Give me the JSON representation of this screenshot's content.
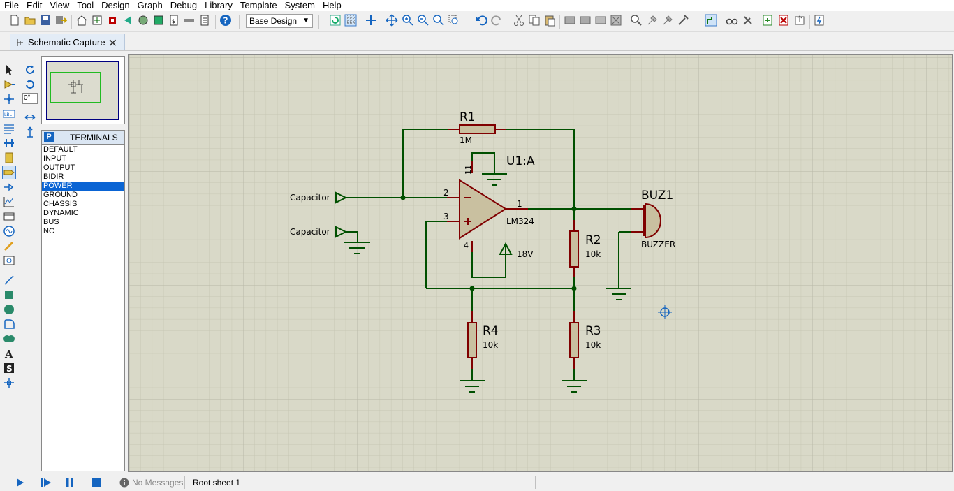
{
  "menu": [
    "File",
    "Edit",
    "View",
    "Tool",
    "Design",
    "Graph",
    "Debug",
    "Library",
    "Template",
    "System",
    "Help"
  ],
  "toolbar": {
    "design_select": "Base Design"
  },
  "tab": {
    "label": "Schematic Capture"
  },
  "rotation": {
    "angle": "0°"
  },
  "terminals": {
    "badge": "P",
    "header": "TERMINALS",
    "items": [
      "DEFAULT",
      "INPUT",
      "OUTPUT",
      "BIDIR",
      "POWER",
      "GROUND",
      "CHASSIS",
      "DYNAMIC",
      "BUS",
      "NC"
    ],
    "selected": "POWER"
  },
  "schematic": {
    "r1": {
      "ref": "R1",
      "value": "1M"
    },
    "r2": {
      "ref": "R2",
      "value": "10k"
    },
    "r3": {
      "ref": "R3",
      "value": "10k"
    },
    "r4": {
      "ref": "R4",
      "value": "10k"
    },
    "u1": {
      "ref": "U1:A",
      "value": "LM324",
      "pin_minus": "2",
      "pin_plus": "3",
      "pin_out": "1",
      "pin_vcc": "4",
      "pin_gnd": "11"
    },
    "buzzer": {
      "ref": "BUZ1",
      "value": "BUZZER"
    },
    "supply": {
      "label": "18V"
    },
    "term1": {
      "label": "Capacitor"
    },
    "term2": {
      "label": "Capacitor"
    }
  },
  "status": {
    "messages": "No Messages",
    "sheet": "Root sheet 1"
  },
  "colors": {
    "wire": "#005000",
    "component": "#800000",
    "fill": "#c9c0a0",
    "canvas": "#d9d9c8",
    "grid": "#c4c4b2",
    "selected": "#0a64d4"
  }
}
